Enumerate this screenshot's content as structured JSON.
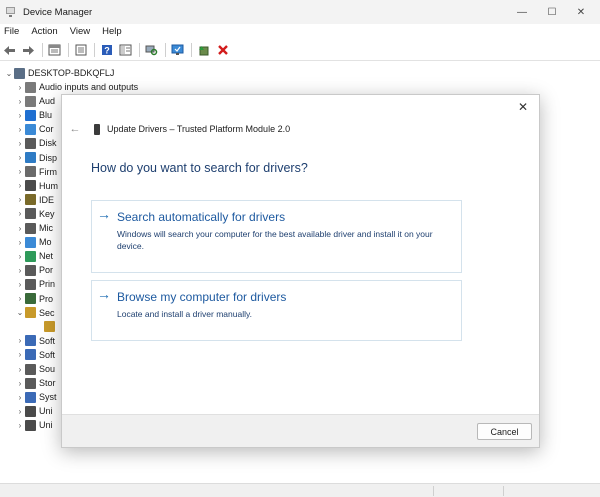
{
  "window": {
    "title": "Device Manager",
    "minimize_glyph": "—",
    "maximize_glyph": "☐",
    "close_glyph": "✕"
  },
  "menu": [
    "File",
    "Action",
    "View",
    "Help"
  ],
  "toolbar": {
    "buttons": [
      "back-arrow-icon",
      "forward-arrow-icon",
      "device-tree-icon",
      "properties-icon",
      "help-icon",
      "view-icon",
      "scan-hardware-icon",
      "monitor-icon",
      "update-driver-icon",
      "uninstall-device-icon"
    ]
  },
  "tree": {
    "root_label": "DESKTOP-BDKQFLJ",
    "items": [
      {
        "label": "Audio inputs and outputs",
        "chev": "›",
        "color": "#7a7a7a"
      },
      {
        "label": "Aud",
        "chev": "›",
        "color": "#7a7a7a"
      },
      {
        "label": "Blu",
        "chev": "›",
        "color": "#1f6fd1"
      },
      {
        "label": "Cor",
        "chev": "›",
        "color": "#3b8ad6"
      },
      {
        "label": "Disk",
        "chev": "›",
        "color": "#5a5a5a"
      },
      {
        "label": "Disp",
        "chev": "›",
        "color": "#2e7bc4"
      },
      {
        "label": "Firm",
        "chev": "›",
        "color": "#6a6a6a"
      },
      {
        "label": "Hum",
        "chev": "›",
        "color": "#4a4a4a"
      },
      {
        "label": "IDE",
        "chev": "›",
        "color": "#7a6a2a"
      },
      {
        "label": "Key",
        "chev": "›",
        "color": "#5a5a5a"
      },
      {
        "label": "Mic",
        "chev": "›",
        "color": "#5a5a5a"
      },
      {
        "label": "Mo",
        "chev": "›",
        "color": "#3b8ad6"
      },
      {
        "label": "Net",
        "chev": "›",
        "color": "#2e9a5a"
      },
      {
        "label": "Por",
        "chev": "›",
        "color": "#5a5a5a"
      },
      {
        "label": "Prin",
        "chev": "›",
        "color": "#5a5a5a"
      },
      {
        "label": "Pro",
        "chev": "›",
        "color": "#3a6a3a"
      },
      {
        "label": "Sec",
        "chev": "⌄",
        "color": "#c89a2a"
      },
      {
        "label": "",
        "chev": "",
        "color": "#c89a2a"
      },
      {
        "label": "Soft",
        "chev": "›",
        "color": "#3b6ab6"
      },
      {
        "label": "Soft",
        "chev": "›",
        "color": "#3b6ab6"
      },
      {
        "label": "Sou",
        "chev": "›",
        "color": "#5a5a5a"
      },
      {
        "label": "Stor",
        "chev": "›",
        "color": "#5a5a5a"
      },
      {
        "label": "Syst",
        "chev": "›",
        "color": "#3b6ab6"
      },
      {
        "label": "Uni",
        "chev": "›",
        "color": "#4a4a4a"
      },
      {
        "label": "Uni",
        "chev": "›",
        "color": "#4a4a4a"
      }
    ]
  },
  "dialog": {
    "close_glyph": "✕",
    "back_glyph": "←",
    "title": "Update Drivers – Trusted Platform Module 2.0",
    "heading": "How do you want to search for drivers?",
    "options": [
      {
        "arrow": "→",
        "title": "Search automatically for drivers",
        "description": "Windows will search your computer for the best available driver and install it on your device."
      },
      {
        "arrow": "→",
        "title": "Browse my computer for drivers",
        "description": "Locate and install a driver manually."
      }
    ],
    "cancel_label": "Cancel"
  },
  "colors": {
    "heading": "#1e3f6f",
    "link": "#1e5aa0",
    "arrow": "#1e6db3"
  }
}
